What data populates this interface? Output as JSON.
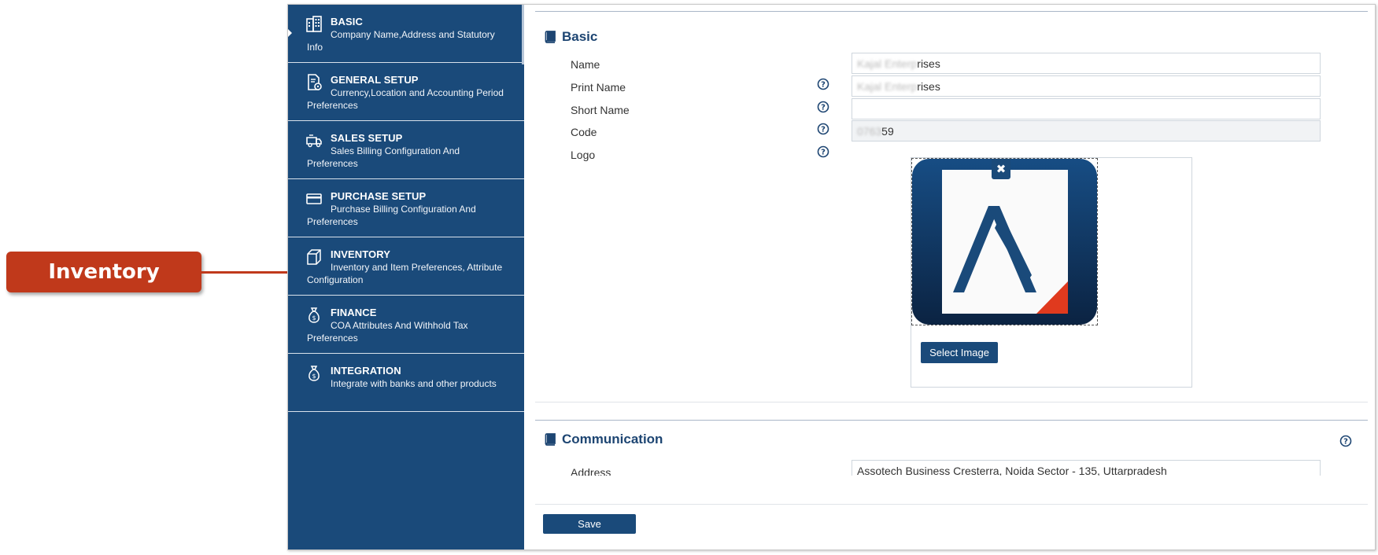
{
  "callout": {
    "label": "Inventory"
  },
  "sidebar": {
    "items": [
      {
        "title": "BASIC",
        "desc": "Company Name,Address and Statutory Info",
        "icon": "building-icon"
      },
      {
        "title": "GENERAL SETUP",
        "desc": "Currency,Location and Accounting Period Preferences",
        "icon": "settings-doc-icon"
      },
      {
        "title": "SALES SETUP",
        "desc": "Sales Billing Configuration And Preferences",
        "icon": "truck-icon"
      },
      {
        "title": "PURCHASE SETUP",
        "desc": "Purchase Billing Configuration And Preferences",
        "icon": "card-icon"
      },
      {
        "title": "INVENTORY",
        "desc": "Inventory and Item Preferences, Attribute Configuration",
        "icon": "box-icon"
      },
      {
        "title": "FINANCE",
        "desc": "COA Attributes And Withhold Tax Preferences",
        "icon": "money-bag-icon"
      },
      {
        "title": "INTEGRATION",
        "desc": "Integrate with banks and other products",
        "icon": "money-bag-icon"
      }
    ]
  },
  "basic": {
    "title": "Basic",
    "name_label": "Name",
    "name_value_blur": "Kajal Enterp",
    "name_value": "rises",
    "print_name_label": "Print Name",
    "print_name_value_blur": "Kajal Enterp",
    "print_name_value": "rises",
    "short_name_label": "Short Name",
    "short_name_value": "",
    "code_label": "Code",
    "code_value_blur": "0763",
    "code_value": "59",
    "logo_label": "Logo",
    "remove_label": "✖",
    "select_image_label": "Select Image"
  },
  "communication": {
    "title": "Communication",
    "address_label": "Address",
    "address_value": "Assotech Business Cresterra, Noida Sector - 135, Uttarpradesh"
  },
  "footer": {
    "save_label": "Save"
  },
  "colors": {
    "brand": "#1a4a7a",
    "callout": "#c0391b",
    "logo_accent": "#e03a1e"
  }
}
